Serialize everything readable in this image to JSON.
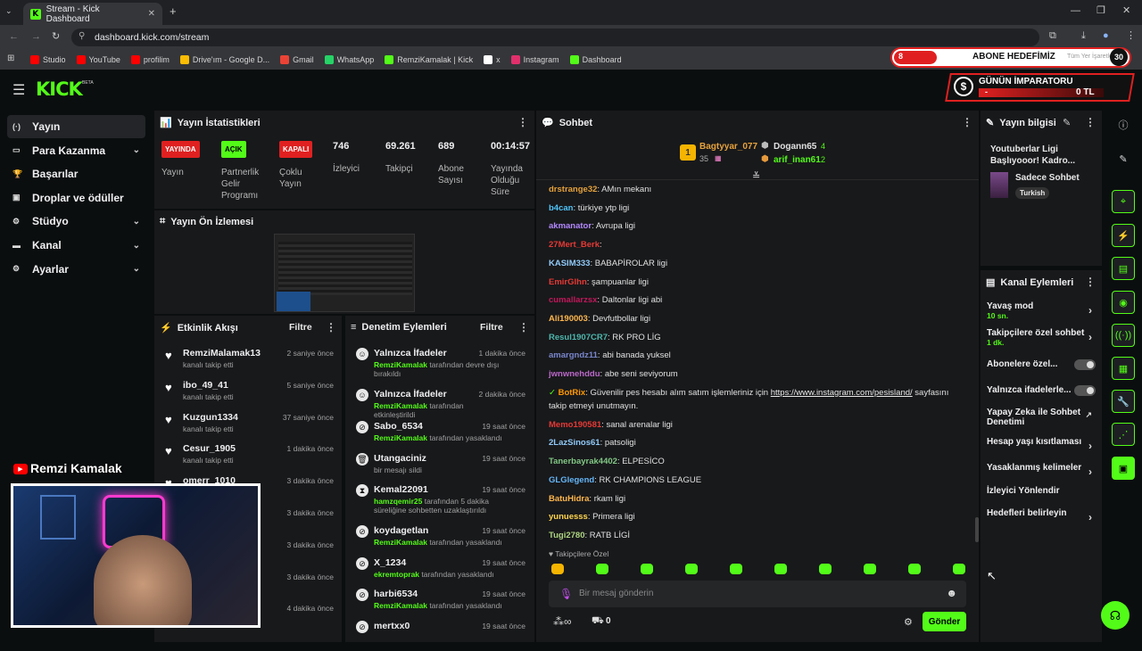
{
  "browser": {
    "tab_title": "Stream - Kick Dashboard",
    "url": "dashboard.kick.com/stream",
    "bookmarks": [
      {
        "label": "Studio",
        "color": "#ff0000"
      },
      {
        "label": "YouTube",
        "color": "#ff0000"
      },
      {
        "label": "profilim",
        "color": "#ff0000"
      },
      {
        "label": "Drive'ım - Google D...",
        "color": "#fbbc04"
      },
      {
        "label": "Gmail",
        "color": "#ea4335"
      },
      {
        "label": "WhatsApp",
        "color": "#25d366"
      },
      {
        "label": "RemziKamalak | Kick",
        "color": "#53fc18"
      },
      {
        "label": "x",
        "color": "#ffffff"
      },
      {
        "label": "Instagram",
        "color": "#e1306c"
      },
      {
        "label": "Dashboard",
        "color": "#53fc18"
      }
    ],
    "all_bookmarks": "Tüm Yer İşaretleri"
  },
  "overlay": {
    "sub_goal": "ABONE HEDEFİMİZ",
    "sub_goal_current": "8",
    "sub_goal_target": "30",
    "emperor_title": "GÜNÜN İMPARATORU",
    "emperor_name": "-",
    "emperor_amount": "0 TL",
    "streamer_name": "Remzi Kamalak"
  },
  "logo": "KICK",
  "logo_beta": "BETA",
  "sidebar": [
    {
      "label": "Yayın",
      "icon": "(·)",
      "chevron": false
    },
    {
      "label": "Para Kazanma",
      "icon": "▭",
      "chevron": true
    },
    {
      "label": "Başarılar",
      "icon": "🏆",
      "chevron": false
    },
    {
      "label": "Droplar ve ödüller",
      "icon": "▣",
      "chevron": false
    },
    {
      "label": "Stüdyo",
      "icon": "⚙",
      "chevron": true
    },
    {
      "label": "Kanal",
      "icon": "▬",
      "chevron": true
    },
    {
      "label": "Ayarlar",
      "icon": "⚙",
      "chevron": true
    }
  ],
  "stats": {
    "title": "Yayın İstatistikleri",
    "yayin": {
      "badge": "YAYINDA",
      "label": "Yayın"
    },
    "partner": {
      "badge": "AÇIK",
      "label": "Partnerlik Gelir Programı"
    },
    "multi": {
      "badge": "KAPALI",
      "label": "Çoklu Yayın"
    },
    "viewers": {
      "value": "746",
      "label": "İzleyici"
    },
    "followers": {
      "value": "69.261",
      "label": "Takipçi"
    },
    "subs": {
      "value": "689",
      "label": "Abone Sayısı"
    },
    "uptime": {
      "value": "00:14:57",
      "label": "Yayında Olduğu Süre"
    }
  },
  "preview": {
    "title": "Yayın Ön İzlemesi"
  },
  "activity": {
    "title": "Etkinlik Akışı",
    "filter": "Filtre",
    "items": [
      {
        "name": "RemziMalamak13",
        "sub": "kanalı takip etti",
        "time": "2 saniye önce"
      },
      {
        "name": "ibo_49_41",
        "sub": "kanalı takip etti",
        "time": "5 saniye önce"
      },
      {
        "name": "Kuzgun1334",
        "sub": "kanalı takip etti",
        "time": "37 saniye önce"
      },
      {
        "name": "Cesur_1905",
        "sub": "kanalı takip etti",
        "time": "1 dakika önce"
      },
      {
        "name": "omerr_1010",
        "sub": "",
        "time": "3 dakika önce"
      },
      {
        "name": "",
        "sub": "",
        "time": "3 dakika önce"
      },
      {
        "name": "",
        "sub": "",
        "time": "3 dakika önce"
      },
      {
        "name": "",
        "sub": "",
        "time": "3 dakika önce"
      },
      {
        "name": "",
        "sub": "",
        "time": "4 dakika önce"
      }
    ]
  },
  "moderation": {
    "title": "Denetim Eylemleri",
    "filter": "Filtre",
    "items": [
      {
        "icon": "☺",
        "name": "Yalnızca İfadeler",
        "actor": "RemziKamalak",
        "text": " tarafından devre dışı bırakıldı",
        "time": "1 dakika önce"
      },
      {
        "icon": "☺",
        "name": "Yalnızca İfadeler",
        "actor": "RemziKamalak",
        "text": " tarafından etkinleştirildi",
        "time": "2 dakika önce"
      },
      {
        "icon": "⊘",
        "name": "Sabo_6534",
        "actor": "RemziKamalak",
        "text": " tarafından yasaklandı",
        "time": "19 saat önce"
      },
      {
        "icon": "🗑",
        "name": "Utangaciniz",
        "actor": "",
        "text": "bir mesajı sildi",
        "time": "19 saat önce"
      },
      {
        "icon": "⧗",
        "name": "Kemal22091",
        "actor": "hamzqemir25",
        "text": " tarafından 5 dakika süreliğine sohbetten uzaklaştırıldı",
        "time": "19 saat önce"
      },
      {
        "icon": "⊘",
        "name": "koydagetlan",
        "actor": "RemziKamalak",
        "text": " tarafından yasaklandı",
        "time": "19 saat önce"
      },
      {
        "icon": "⊘",
        "name": "X_1234",
        "actor": "ekremtoprak",
        "text": " tarafından yasaklandı",
        "time": "19 saat önce"
      },
      {
        "icon": "⊘",
        "name": "harbi6534",
        "actor": "RemziKamalak",
        "text": " tarafından yasaklandı",
        "time": "19 saat önce"
      },
      {
        "icon": "⊘",
        "name": "mertxx0",
        "actor": "",
        "text": "",
        "time": "19 saat önce"
      }
    ]
  },
  "chat": {
    "title": "Sohbet",
    "top": [
      {
        "rank": "1",
        "name": "Bagtyyar_077",
        "count": "35"
      },
      {
        "name": "Dogann65",
        "count": "4"
      },
      {
        "name": "arif_inan61",
        "count": "2"
      }
    ],
    "messages": [
      {
        "user": "drstrange32",
        "color": "#e6a23c",
        "text": "AMın mekanı"
      },
      {
        "user": "b4can",
        "color": "#4fc3f7",
        "text": "türkiye ytp ligi"
      },
      {
        "user": "akmanator",
        "color": "#b388ff",
        "text": "Avrupa ligi"
      },
      {
        "user": "27Mert_Berk",
        "color": "#e53935",
        "text": ""
      },
      {
        "user": "KASIM333",
        "color": "#90caf9",
        "text": "BABAPİROLAR ligi"
      },
      {
        "user": "EmirGlhn",
        "color": "#e53935",
        "text": "şampuanlar ligi"
      },
      {
        "user": "cumallarzsx",
        "color": "#c2185b",
        "text": "Daltonlar ligi abi"
      },
      {
        "user": "Ali190003",
        "color": "#ffb74d",
        "text": "Devfutbollar ligi"
      },
      {
        "user": "Resul1907CR7",
        "color": "#4db6ac",
        "text": "RK PRO LİG"
      },
      {
        "user": "amargndz11",
        "color": "#7986cb",
        "text": "abi banada yuksel"
      },
      {
        "user": "jwnwnehddu",
        "color": "#ba68c8",
        "text": "abe seni seviyorum"
      },
      {
        "user": "BotRix",
        "color": "#ff9800",
        "text": "Güvenilir pes hesabı alım satım işlemleriniz için ",
        "link": "https://www.instagram.com/pesisland/",
        "tail": " sayfasını takip etmeyi unutmayın."
      },
      {
        "user": "Memo190581",
        "color": "#e53935",
        "text": "sanal arenalar ligi"
      },
      {
        "user": "2LazSinos61",
        "color": "#90caf9",
        "text": "patsoligi"
      },
      {
        "user": "Tanerbayrak4402",
        "color": "#81c784",
        "text": "ELPESİCO"
      },
      {
        "user": "GLGlegend",
        "color": "#64b5f6",
        "text": "RK CHAMPIONS LEAGUE"
      },
      {
        "user": "BatuHidra",
        "color": "#ffb74d",
        "text": "rkam ligi"
      },
      {
        "user": "yunuesss",
        "color": "#ffd54f",
        "text": "Primera ligi"
      },
      {
        "user": "Tugi2780",
        "color": "#aed581",
        "text": "RATB LİGİ"
      }
    ],
    "followers_only": "Takipçilere Özel",
    "input_placeholder": "Bir mesaj gönderin",
    "points": "0",
    "send": "Gönder"
  },
  "stream_info": {
    "title": "Yayın bilgisi",
    "stream_title": "Youtuberlar Ligi Başlıyooor! Kadro...",
    "category": "Sadece Sohbet",
    "tag": "Turkish"
  },
  "channel_actions": {
    "title": "Kanal Eylemleri",
    "items": [
      {
        "label": "Yavaş mod",
        "sub": "10 sn.",
        "type": "chevron"
      },
      {
        "label": "Takipçilere özel sohbet",
        "sub": "1 dk.",
        "type": "chevron"
      },
      {
        "label": "Abonelere özel...",
        "sub": "",
        "type": "toggle"
      },
      {
        "label": "Yalnızca ifadelerle...",
        "sub": "",
        "type": "toggle"
      },
      {
        "label": "Yapay Zeka ile Sohbet Denetimi",
        "sub": "",
        "type": "external"
      },
      {
        "label": "Hesap yaşı kısıtlaması",
        "sub": "",
        "type": "chevron"
      },
      {
        "label": "Yasaklanmış kelimeler",
        "sub": "",
        "type": "chevron"
      },
      {
        "label": "İzleyici Yönlendir",
        "sub": "",
        "type": "none"
      },
      {
        "label": "Hedefleri belirleyin",
        "sub": "",
        "type": "chevron"
      }
    ]
  },
  "colors": {
    "accent": "#53fc18",
    "panel": "#18191b",
    "bg": "#0b0e0f"
  }
}
